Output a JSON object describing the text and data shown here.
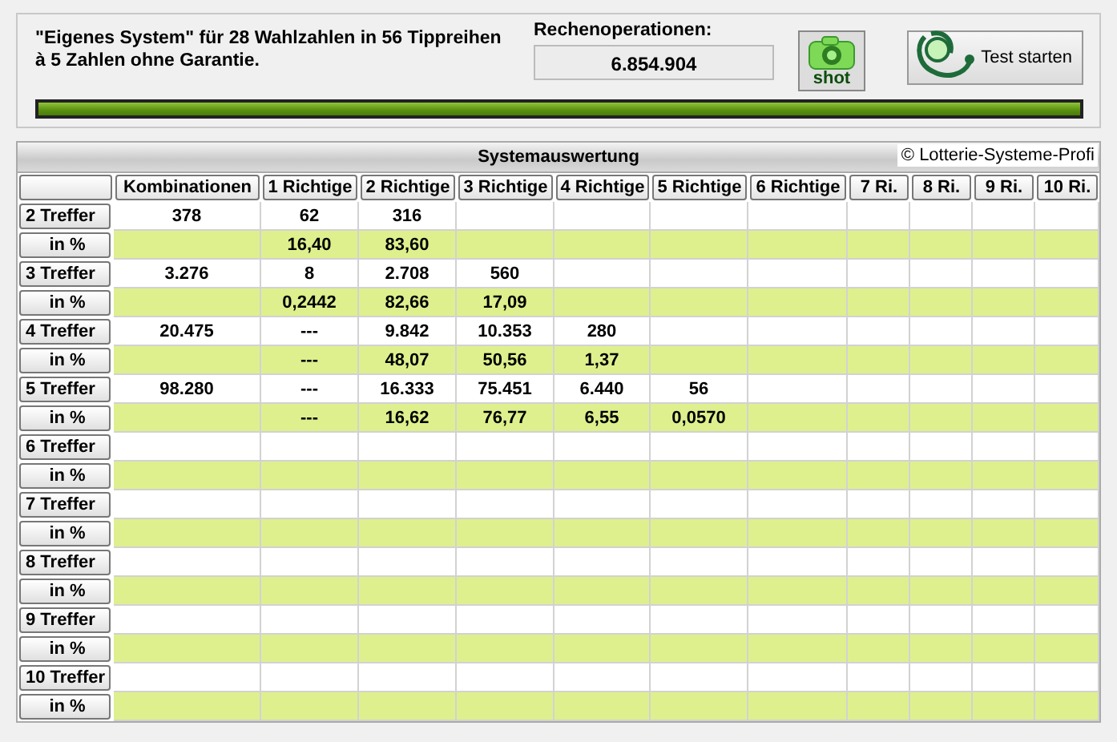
{
  "header": {
    "description_lines": [
      "\"Eigenes System\" für 28 Wahlzahlen in 56 Tippreihen",
      "à 5 Zahlen ohne Garantie."
    ],
    "operations_label": "Rechenoperationen:",
    "operations_value": "6.854.904",
    "shot_button": "shot",
    "test_button": "Test starten",
    "progress": {
      "level": 1
    }
  },
  "table": {
    "title": "Systemauswertung",
    "copyright": "© Lotterie-Systeme-Profi",
    "columns": [
      "Kombinationen",
      "1 Richtige",
      "2 Richtige",
      "3 Richtige",
      "4 Richtige",
      "5 Richtige",
      "6 Richtige",
      "7 Ri.",
      "8 Ri.",
      "9 Ri.",
      "10 Ri."
    ],
    "rows": [
      {
        "label": "2 Treffer",
        "kind": "count",
        "cells": [
          "378",
          "62",
          "316"
        ]
      },
      {
        "label": "in %",
        "kind": "percent",
        "cells": [
          null,
          "16,40",
          "83,60"
        ]
      },
      {
        "label": "3 Treffer",
        "kind": "count",
        "cells": [
          "3.276",
          "8",
          "2.708",
          "560"
        ]
      },
      {
        "label": "in %",
        "kind": "percent",
        "cells": [
          null,
          "0,2442",
          "82,66",
          "17,09"
        ]
      },
      {
        "label": "4 Treffer",
        "kind": "count",
        "cells": [
          "20.475",
          "---",
          "9.842",
          "10.353",
          "280"
        ]
      },
      {
        "label": "in %",
        "kind": "percent",
        "cells": [
          null,
          "---",
          "48,07",
          "50,56",
          "1,37"
        ]
      },
      {
        "label": "5 Treffer",
        "kind": "count",
        "cells": [
          "98.280",
          "---",
          "16.333",
          "75.451",
          "6.440",
          "56"
        ]
      },
      {
        "label": "in %",
        "kind": "percent",
        "cells": [
          null,
          "---",
          "16,62",
          "76,77",
          "6,55",
          "0,0570"
        ]
      },
      {
        "label": "6 Treffer",
        "kind": "count"
      },
      {
        "label": "in %",
        "kind": "percent"
      },
      {
        "label": "7 Treffer",
        "kind": "count"
      },
      {
        "label": "in %",
        "kind": "percent"
      },
      {
        "label": "8 Treffer",
        "kind": "count"
      },
      {
        "label": "in %",
        "kind": "percent"
      },
      {
        "label": "9 Treffer",
        "kind": "count"
      },
      {
        "label": "in %",
        "kind": "percent"
      },
      {
        "label": "10 Treffer",
        "kind": "count"
      },
      {
        "label": "in %",
        "kind": "percent"
      }
    ]
  }
}
